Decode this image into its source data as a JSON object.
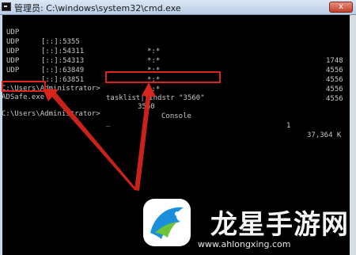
{
  "window": {
    "title": "管理员: C:\\windows\\system32\\cmd.exe",
    "close_label": "x"
  },
  "netstat_rows": [
    {
      "proto": "UDP",
      "local": "[::]:5355",
      "foreign": "*:*",
      "pid": "1748"
    },
    {
      "proto": "UDP",
      "local": "[::]:54311",
      "foreign": "*:*",
      "pid": "4556"
    },
    {
      "proto": "UDP",
      "local": "[::]:54313",
      "foreign": "*:*",
      "pid": "4556"
    },
    {
      "proto": "UDP",
      "local": "[::]:63849",
      "foreign": "*:*",
      "pid": "4556"
    },
    {
      "proto": "UDP",
      "local": "[::]:63851",
      "foreign": "*:*",
      "pid": "4556"
    }
  ],
  "command": {
    "prompt": "C:\\Users\\Administrator>",
    "text": "tasklist|findstr \"3560\""
  },
  "result": {
    "image_name": "ADSafe.exe",
    "pid": "3560",
    "session_name": "Console",
    "session_num": "1",
    "mem_usage": "37,364 K"
  },
  "final_prompt": "C:\\Users\\Administrator>",
  "watermark": {
    "title": "龙星手游网",
    "url": "www.ahlongxing.com"
  },
  "colors": {
    "annotation": "#d9251c",
    "console_text": "#c8c8c8"
  }
}
